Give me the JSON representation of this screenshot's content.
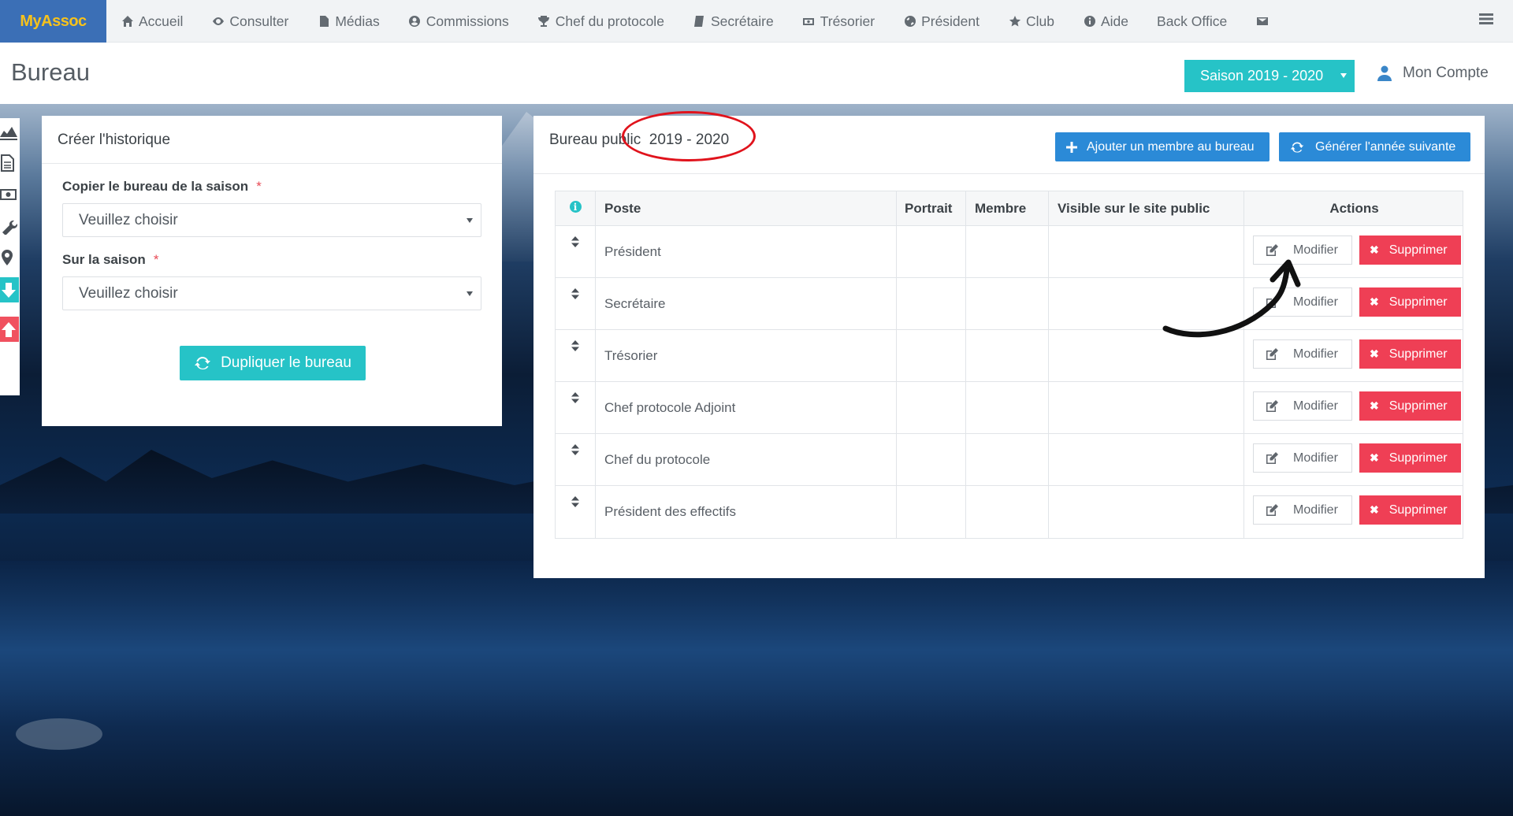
{
  "brand": "MyAssoc",
  "nav": [
    {
      "label": "Accueil",
      "icon": "home-icon"
    },
    {
      "label": "Consulter",
      "icon": "eye-icon"
    },
    {
      "label": "Médias",
      "icon": "file-icon"
    },
    {
      "label": "Commissions",
      "icon": "user-circle-icon"
    },
    {
      "label": "Chef du protocole",
      "icon": "trophy-icon"
    },
    {
      "label": "Secrétaire",
      "icon": "book-icon"
    },
    {
      "label": "Trésorier",
      "icon": "money-icon"
    },
    {
      "label": "Président",
      "icon": "globe-icon"
    },
    {
      "label": "Club",
      "icon": "star-icon"
    },
    {
      "label": "Aide",
      "icon": "info-icon"
    },
    {
      "label": "Back Office",
      "icon": ""
    },
    {
      "label": "",
      "icon": "envelope-icon"
    }
  ],
  "header": {
    "title": "Bureau",
    "season": "Saison 2019 - 2020",
    "account": "Mon Compte"
  },
  "history": {
    "title": "Créer l'historique",
    "copy_label": "Copier le bureau de la saison",
    "copy_value": "Veuillez choisir",
    "target_label": "Sur la saison",
    "target_value": "Veuillez choisir",
    "required_mark": "*",
    "duplicate_button": "Dupliquer le bureau"
  },
  "bureau": {
    "title": "Bureau public  2019 - 2020",
    "add_button": "Ajouter un membre au bureau",
    "generate_button": "Générer l'année suivante",
    "columns": [
      "Poste",
      "Portrait",
      "Membre",
      "Visible sur le site public",
      "Actions"
    ],
    "edit_label": "Modifier",
    "delete_label": "Supprimer",
    "rows": [
      {
        "poste": "Président"
      },
      {
        "poste": "Secrétaire"
      },
      {
        "poste": "Trésorier"
      },
      {
        "poste": "Chef protocole Adjoint"
      },
      {
        "poste": "Chef du protocole"
      },
      {
        "poste": "Président des effectifs"
      }
    ]
  },
  "colors": {
    "brand_bg": "#3b6fb6",
    "brand_text": "#f7c21b",
    "accent_teal": "#26c3c7",
    "primary_blue": "#2b8ad7",
    "danger_red": "#ef3f55",
    "annotation_red": "#e0131c"
  }
}
